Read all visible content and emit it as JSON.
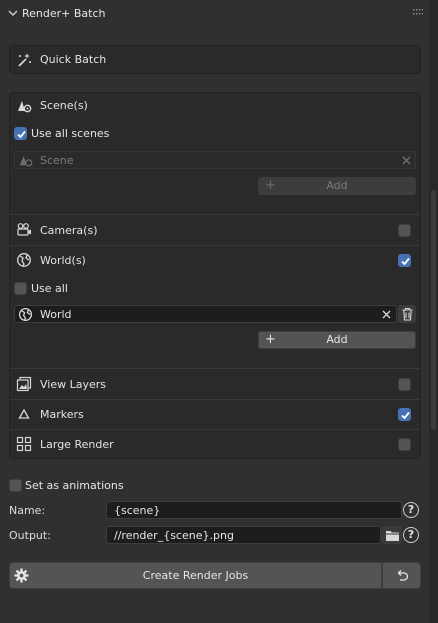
{
  "panel": {
    "title": "Render+ Batch",
    "quick_batch_label": "Quick Batch",
    "scenes": {
      "header": "Scene(s)",
      "use_all_label": "Use all scenes",
      "use_all_checked": true,
      "scene_field_value": "Scene",
      "add_label": "Add"
    },
    "cameras": {
      "label": "Camera(s)",
      "checked": false
    },
    "worlds": {
      "label": "World(s)",
      "checked": true,
      "use_all_label": "Use all",
      "use_all_checked": false,
      "world_field_value": "World",
      "add_label": "Add"
    },
    "view_layers": {
      "label": "View Layers",
      "checked": false
    },
    "markers": {
      "label": "Markers",
      "checked": true
    },
    "large_render": {
      "label": "Large Render",
      "checked": false
    },
    "set_as_animations": {
      "label": "Set as animations",
      "checked": false
    },
    "name_field": {
      "label": "Name:",
      "value": "{scene}"
    },
    "output_field": {
      "label": "Output:",
      "value": "//render_{scene}.png"
    },
    "create_button_label": "Create Render Jobs",
    "help_glyph": "?",
    "add_glyph": "+"
  },
  "colors": {
    "accent": "#4772b3",
    "panel_bg": "#303030",
    "box_bg": "#2a2a2a",
    "field_bg": "#1d1d1d"
  },
  "icons": [
    "chevron-down-icon",
    "grip-icon",
    "magic-wand-icon",
    "scene-icon",
    "checkmark-icon",
    "close-icon",
    "plus-icon",
    "camera-icon",
    "world-icon",
    "trash-icon",
    "view-layers-icon",
    "marker-icon",
    "large-render-icon",
    "folder-icon",
    "help-icon",
    "gear-icon",
    "undo-icon"
  ]
}
